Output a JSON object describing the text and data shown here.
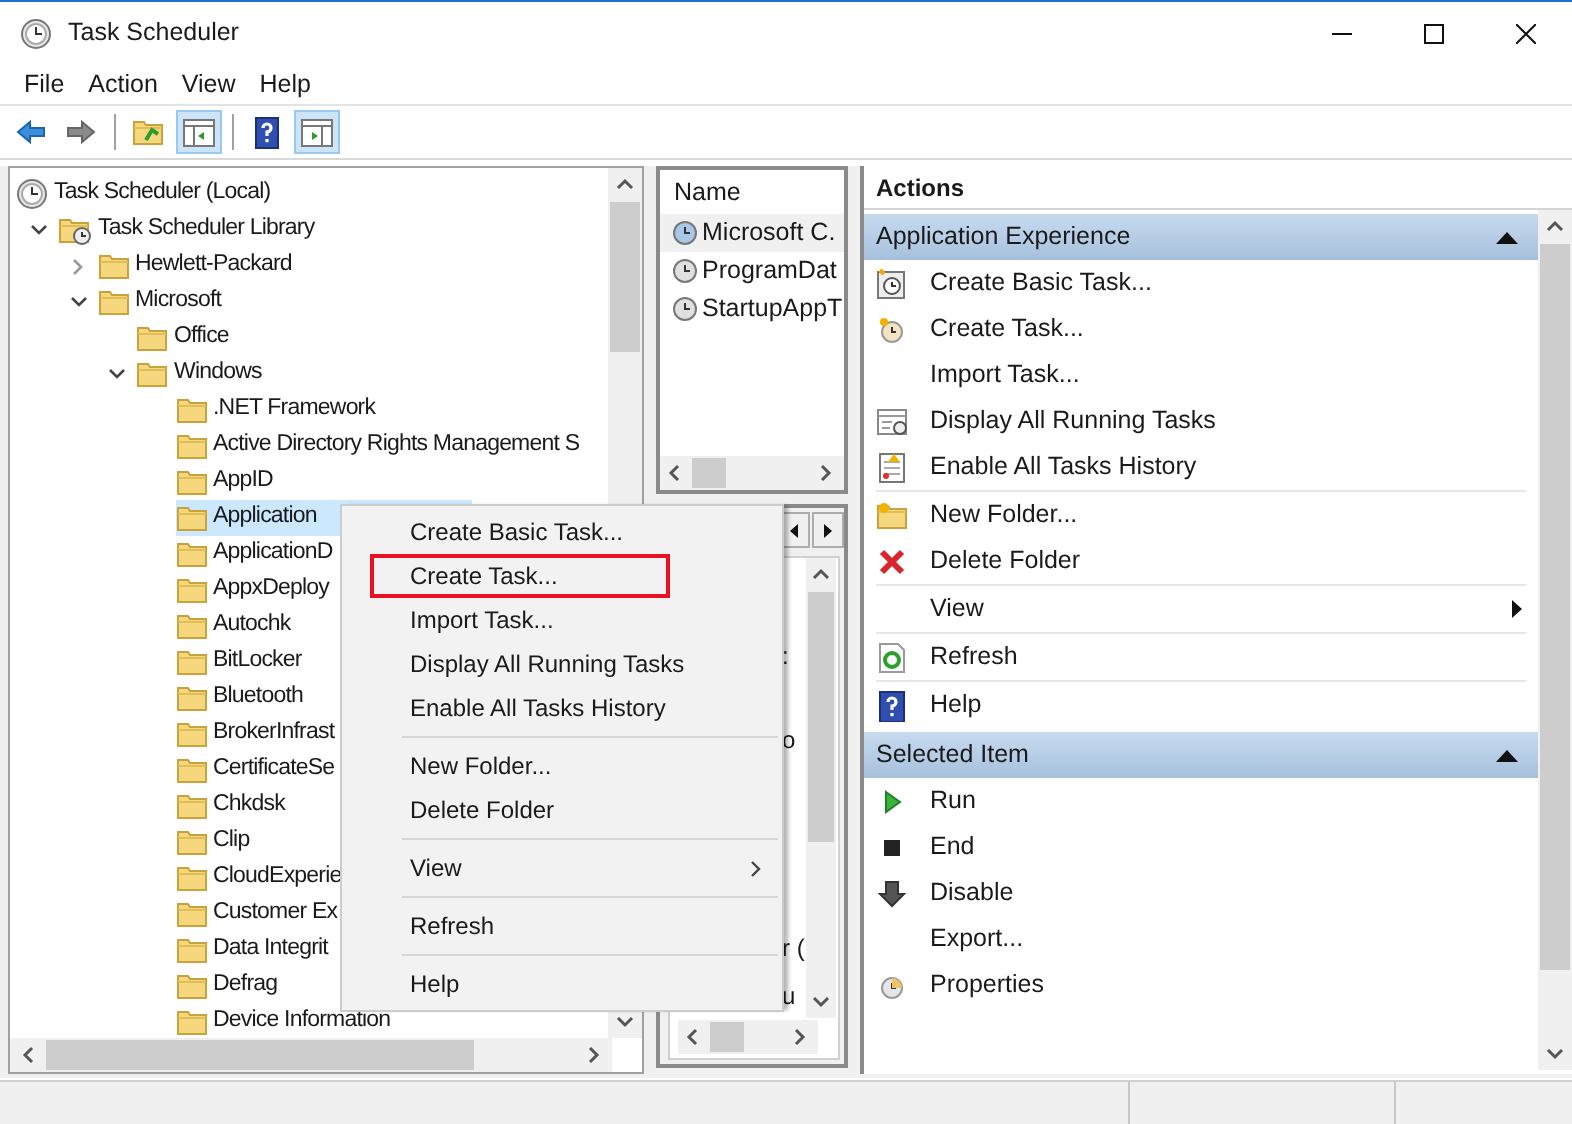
{
  "window": {
    "title": "Task Scheduler"
  },
  "menu_bar": [
    "File",
    "Action",
    "View",
    "Help"
  ],
  "toolbar": [
    {
      "kind": "back",
      "on": false
    },
    {
      "kind": "forward",
      "on": false
    },
    {
      "kind": "up",
      "on": false
    },
    {
      "kind": "treepane",
      "on": true
    },
    {
      "kind": "help",
      "on": false
    },
    {
      "kind": "actionpane",
      "on": true
    }
  ],
  "tree": [
    {
      "label": "Task Scheduler (Local)",
      "kind": "root",
      "selected": false,
      "children": [
        {
          "label": "Task Scheduler Library",
          "kind": "library",
          "expanded": true,
          "selected": false,
          "children": [
            {
              "label": "Hewlett-Packard",
              "kind": "folder",
              "expanded": false,
              "selected": false
            },
            {
              "label": "Microsoft",
              "kind": "folder",
              "expanded": true,
              "selected": false,
              "children": [
                {
                  "label": "Office",
                  "kind": "folder",
                  "selected": false
                },
                {
                  "label": "Windows",
                  "kind": "folder",
                  "expanded": true,
                  "selected": false,
                  "children": [
                    {
                      "label": ".NET Framework",
                      "kind": "folder",
                      "selected": false
                    },
                    {
                      "label": "Active Directory Rights Management S",
                      "kind": "folder",
                      "selected": false
                    },
                    {
                      "label": "AppID",
                      "kind": "folder",
                      "selected": false
                    },
                    {
                      "label": "Application",
                      "kind": "folder",
                      "selected": true
                    },
                    {
                      "label": "ApplicationD",
                      "kind": "folder",
                      "selected": false
                    },
                    {
                      "label": "AppxDeploy",
                      "kind": "folder",
                      "selected": false
                    },
                    {
                      "label": "Autochk",
                      "kind": "folder",
                      "selected": false
                    },
                    {
                      "label": "BitLocker",
                      "kind": "folder",
                      "selected": false
                    },
                    {
                      "label": "Bluetooth",
                      "kind": "folder",
                      "selected": false
                    },
                    {
                      "label": "BrokerInfrast",
                      "kind": "folder",
                      "selected": false
                    },
                    {
                      "label": "CertificateSe",
                      "kind": "folder",
                      "selected": false
                    },
                    {
                      "label": "Chkdsk",
                      "kind": "folder",
                      "selected": false
                    },
                    {
                      "label": "Clip",
                      "kind": "folder",
                      "selected": false
                    },
                    {
                      "label": "CloudExperie",
                      "kind": "folder",
                      "selected": false
                    },
                    {
                      "label": "Customer Ex",
                      "kind": "folder",
                      "selected": false
                    },
                    {
                      "label": "Data Integrit",
                      "kind": "folder",
                      "selected": false
                    },
                    {
                      "label": "Defrag",
                      "kind": "folder",
                      "selected": false
                    },
                    {
                      "label": "Device Information",
                      "kind": "folder",
                      "selected": false
                    }
                  ]
                }
              ]
            }
          ]
        }
      ]
    }
  ],
  "task_list": {
    "column": "Name",
    "rows": [
      {
        "name": "Microsoft C.",
        "selected": true
      },
      {
        "name": "ProgramDat",
        "selected": false
      },
      {
        "name": "StartupAppT",
        "selected": false
      }
    ]
  },
  "detail_fragments": [
    ":",
    "o",
    "r (",
    "u"
  ],
  "context_menu": [
    {
      "kind": "item",
      "label": "Create Basic Task...",
      "outlined": false
    },
    {
      "kind": "item",
      "label": "Create Task...",
      "outlined": true
    },
    {
      "kind": "item",
      "label": "Import Task...",
      "outlined": false
    },
    {
      "kind": "item",
      "label": "Display All Running Tasks",
      "outlined": false
    },
    {
      "kind": "item",
      "label": "Enable All Tasks History",
      "outlined": false
    },
    {
      "kind": "separator"
    },
    {
      "kind": "item",
      "label": "New Folder...",
      "outlined": false
    },
    {
      "kind": "item",
      "label": "Delete Folder",
      "outlined": false
    },
    {
      "kind": "separator"
    },
    {
      "kind": "submenu",
      "label": "View",
      "outlined": false
    },
    {
      "kind": "separator"
    },
    {
      "kind": "item",
      "label": "Refresh",
      "outlined": false
    },
    {
      "kind": "separator"
    },
    {
      "kind": "item",
      "label": "Help",
      "outlined": false
    }
  ],
  "actions": {
    "title": "Actions",
    "sections": [
      {
        "title": "Application Experience",
        "expanded": true,
        "items": [
          {
            "label": "Create Basic Task...",
            "kind": "basictask",
            "submenu": false,
            "separator_after": false
          },
          {
            "label": "Create Task...",
            "kind": "task",
            "submenu": false,
            "separator_after": false
          },
          {
            "label": "Import Task...",
            "kind": "plain",
            "submenu": false,
            "separator_after": false
          },
          {
            "label": "Display All Running Tasks",
            "kind": "running",
            "submenu": false,
            "separator_after": false
          },
          {
            "label": "Enable All Tasks History",
            "kind": "history",
            "submenu": false,
            "separator_after": true
          },
          {
            "label": "New Folder...",
            "kind": "newfolder",
            "submenu": false,
            "separator_after": false
          },
          {
            "label": "Delete Folder",
            "kind": "delete",
            "submenu": false,
            "separator_after": true
          },
          {
            "label": "View",
            "kind": "plain",
            "submenu": true,
            "separator_after": true
          },
          {
            "label": "Refresh",
            "kind": "refresh",
            "submenu": false,
            "separator_after": true
          },
          {
            "label": "Help",
            "kind": "help",
            "submenu": false,
            "separator_after": false
          }
        ]
      },
      {
        "title": "Selected Item",
        "expanded": true,
        "items": [
          {
            "label": "Run",
            "kind": "run",
            "submenu": false,
            "separator_after": false
          },
          {
            "label": "End",
            "kind": "end",
            "submenu": false,
            "separator_after": false
          },
          {
            "label": "Disable",
            "kind": "disable",
            "submenu": false,
            "separator_after": false
          },
          {
            "label": "Export...",
            "kind": "plain",
            "submenu": false,
            "separator_after": false
          },
          {
            "label": "Properties",
            "kind": "properties",
            "submenu": false,
            "separator_after": false
          }
        ]
      }
    ]
  }
}
